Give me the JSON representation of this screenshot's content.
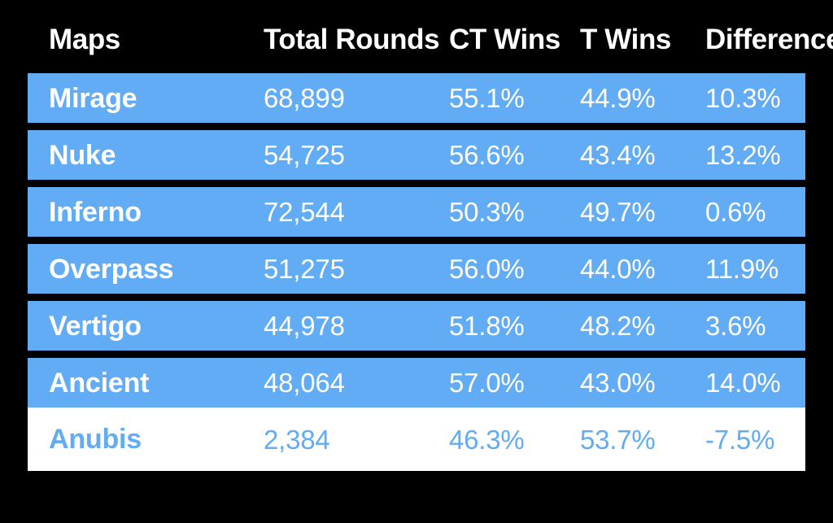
{
  "figure": {
    "background_color": "#000000",
    "accent_color": "#62abf5",
    "text_on_accent": "#ffffff",
    "highlight_row_background": "#ffffff"
  },
  "table": {
    "columns": [
      {
        "key": "map",
        "label": "Maps"
      },
      {
        "key": "total_rounds",
        "label": "Total Rounds"
      },
      {
        "key": "ct_wins",
        "label": "CT Wins"
      },
      {
        "key": "t_wins",
        "label": "T Wins"
      },
      {
        "key": "difference",
        "label": "Difference"
      }
    ],
    "rows": [
      {
        "map": "Mirage",
        "total_rounds": "68,899",
        "ct_wins": "55.1%",
        "t_wins": "44.9%",
        "difference": "10.3%",
        "style": "accent"
      },
      {
        "map": "Nuke",
        "total_rounds": "54,725",
        "ct_wins": "56.6%",
        "t_wins": "43.4%",
        "difference": "13.2%",
        "style": "accent"
      },
      {
        "map": "Inferno",
        "total_rounds": "72,544",
        "ct_wins": "50.3%",
        "t_wins": "49.7%",
        "difference": "0.6%",
        "style": "accent"
      },
      {
        "map": "Overpass",
        "total_rounds": "51,275",
        "ct_wins": "56.0%",
        "t_wins": "44.0%",
        "difference": "11.9%",
        "style": "accent"
      },
      {
        "map": "Vertigo",
        "total_rounds": "44,978",
        "ct_wins": "51.8%",
        "t_wins": "48.2%",
        "difference": "3.6%",
        "style": "accent"
      },
      {
        "map": "Ancient",
        "total_rounds": "48,064",
        "ct_wins": "57.0%",
        "t_wins": "43.0%",
        "difference": "14.0%",
        "style": "accent"
      },
      {
        "map": "Anubis",
        "total_rounds": "2,384",
        "ct_wins": "46.3%",
        "t_wins": "53.7%",
        "difference": "-7.5%",
        "style": "inverted"
      }
    ]
  },
  "chart_data": {
    "type": "table",
    "title": "",
    "columns": [
      "Maps",
      "Total Rounds",
      "CT Wins",
      "T Wins",
      "Difference"
    ],
    "categories": [
      "Mirage",
      "Nuke",
      "Inferno",
      "Overpass",
      "Vertigo",
      "Ancient",
      "Anubis"
    ],
    "series": [
      {
        "name": "Total Rounds",
        "values": [
          68899,
          54725,
          72544,
          51275,
          44978,
          48064,
          2384
        ]
      },
      {
        "name": "CT Wins",
        "unit": "%",
        "values": [
          55.1,
          56.6,
          50.3,
          56.0,
          51.8,
          57.0,
          46.3
        ]
      },
      {
        "name": "T Wins",
        "unit": "%",
        "values": [
          44.9,
          43.4,
          49.7,
          44.0,
          48.2,
          43.0,
          53.7
        ]
      },
      {
        "name": "Difference",
        "unit": "%",
        "values": [
          10.3,
          13.2,
          0.6,
          11.9,
          3.6,
          14.0,
          -7.5
        ]
      }
    ],
    "xlabel": "",
    "ylabel": "",
    "grid": false,
    "legend": "none",
    "highlighted_row": "Anubis"
  }
}
